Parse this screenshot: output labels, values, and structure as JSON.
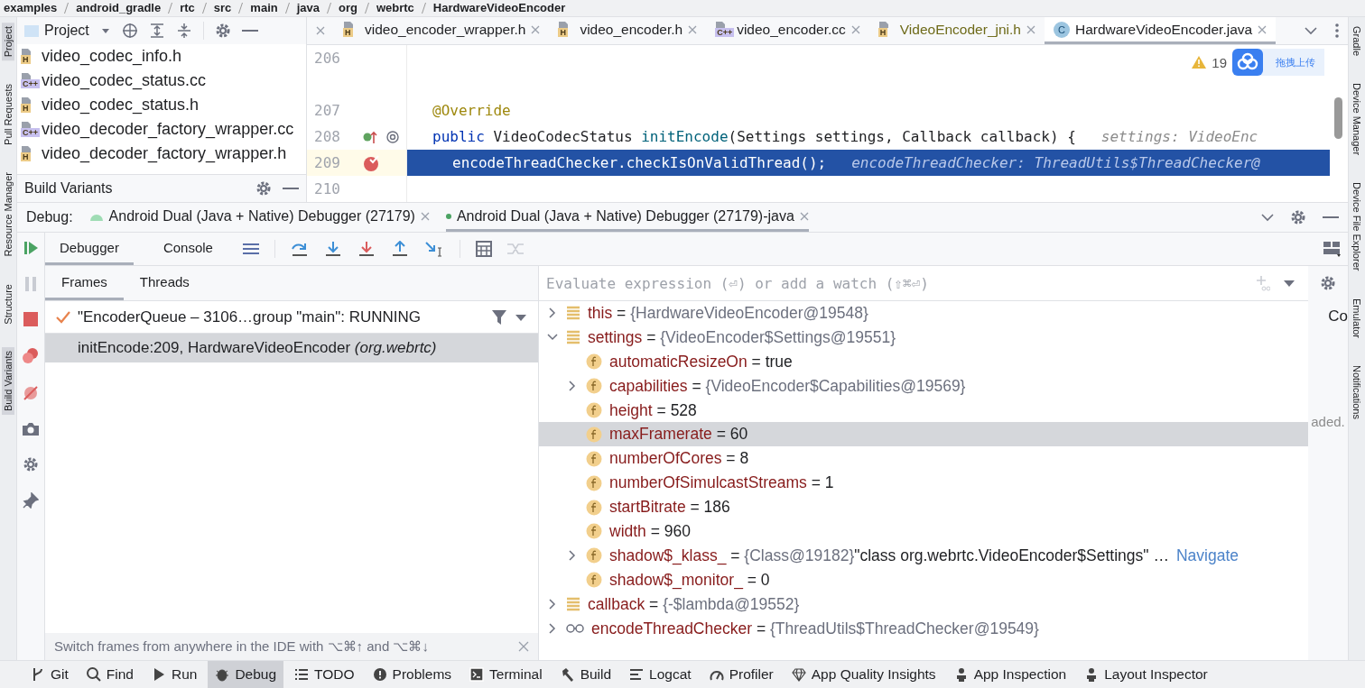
{
  "breadcrumbs": [
    "examples",
    "android_gradle",
    "rtc",
    "src",
    "main",
    "java",
    "org",
    "webrtc",
    "HardwareVideoEncoder"
  ],
  "left_stripe": [
    {
      "label": "Project",
      "selected": true
    },
    {
      "label": "Pull Requests",
      "selected": false
    },
    {
      "label": "Resource Manager",
      "selected": false
    },
    {
      "label": "Structure",
      "selected": false
    },
    {
      "label": "Build Variants",
      "selected": true
    }
  ],
  "right_stripe": [
    {
      "label": "Gradle",
      "selected": false
    },
    {
      "label": "Device Manager",
      "selected": false
    },
    {
      "label": "Device File Explorer",
      "selected": false
    },
    {
      "label": "Emulator",
      "selected": false
    },
    {
      "label": "Notifications",
      "selected": false
    }
  ],
  "project": {
    "title": "Project",
    "files": [
      {
        "name": "video_codec_info.h",
        "badge": "H",
        "color": "#eccb87"
      },
      {
        "name": "video_codec_status.cc",
        "badge": "C++",
        "color": "#c7c0ef"
      },
      {
        "name": "video_codec_status.h",
        "badge": "H",
        "color": "#eccb87"
      },
      {
        "name": "video_decoder_factory_wrapper.cc",
        "badge": "C++",
        "color": "#c7c0ef"
      },
      {
        "name": "video_decoder_factory_wrapper.h",
        "badge": "H",
        "color": "#eccb87"
      }
    ],
    "build_variants": "Build Variants"
  },
  "editor": {
    "tabs": [
      {
        "label": "video_encoder_wrapper.h",
        "kind": "file",
        "badge": "H",
        "color": "#eccb87",
        "modified": false,
        "selected": false
      },
      {
        "label": "video_encoder.h",
        "kind": "file",
        "badge": "H",
        "color": "#eccb87",
        "modified": false,
        "selected": false
      },
      {
        "label": "video_encoder.cc",
        "kind": "file",
        "badge": "C++",
        "color": "#c7c0ef",
        "modified": false,
        "selected": false
      },
      {
        "label": "VideoEncoder_jni.h",
        "kind": "file",
        "badge": "H",
        "color": "#eccb87",
        "modified": true,
        "selected": false
      },
      {
        "label": "HardwareVideoEncoder.java",
        "kind": "class",
        "badge": "C",
        "color": "#9cc5e0",
        "modified": false,
        "selected": true
      }
    ],
    "warnings": "19",
    "upload_widget": "拖拽上传",
    "lines": [
      {
        "number": "206",
        "selected": false
      },
      {
        "number": "207",
        "tokens": [
          {
            "text": "@Override",
            "kind": "annotation"
          }
        ],
        "selected": false
      },
      {
        "number": "208",
        "overrides": true,
        "tokens": [
          {
            "text": "public",
            "kind": "keyword"
          },
          {
            "text": " VideoCodecStatus ",
            "kind": "plain"
          },
          {
            "text": "initEncode",
            "kind": "method"
          },
          {
            "text": "(Settings settings, Callback callback) {",
            "kind": "plain"
          }
        ],
        "hint": "settings: VideoEnc",
        "selected": false
      },
      {
        "number": "209",
        "breakpoint": true,
        "indented": true,
        "tokens": [
          {
            "text": "encodeThreadChecker.checkIsOnValidThread();",
            "kind": "plain"
          }
        ],
        "hint": "encodeThreadChecker: ThreadUtils$ThreadChecker@",
        "selected": true
      },
      {
        "number": "210",
        "selected": false
      }
    ]
  },
  "debug": {
    "label": "Debug:",
    "sessions": [
      {
        "label": "Android Dual (Java + Native) Debugger (27179)",
        "selected": false
      },
      {
        "label": "Android Dual (Java + Native) Debugger (27179)-java",
        "selected": true
      }
    ],
    "tabs": [
      {
        "label": "Debugger",
        "selected": true
      },
      {
        "label": "Console",
        "selected": false
      }
    ],
    "frame_tabs": [
      {
        "label": "Frames",
        "selected": true
      },
      {
        "label": "Threads",
        "selected": false
      }
    ],
    "thread": "\"EncoderQueue – 3106…group \"main\": RUNNING",
    "frames": [
      {
        "method": "initEncode:209, HardwareVideoEncoder",
        "package": "(org.webrtc)",
        "selected": true
      }
    ],
    "hint": "Switch frames from anywhere in the IDE with ⌥⌘↑ and ⌥⌘↓",
    "evaluate_placeholder": "Evaluate expression (⏎) or add a watch (⇧⌘⏎)",
    "variables": [
      {
        "name": "this",
        "operator": "=",
        "value": "{HardwareVideoEncoder@19548}",
        "kind": "local",
        "expandable": true,
        "expanded": false,
        "selected": false
      },
      {
        "name": "settings",
        "operator": "=",
        "value": "{VideoEncoder$Settings@19551}",
        "kind": "local",
        "expandable": true,
        "expanded": true,
        "selected": false,
        "children": [
          {
            "name": "automaticResizeOn",
            "operator": "=",
            "value": "true",
            "kind": "field",
            "expandable": false,
            "expanded": false,
            "selected": false
          },
          {
            "name": "capabilities",
            "operator": "=",
            "value": "{VideoEncoder$Capabilities@19569}",
            "kind": "field",
            "expandable": true,
            "expanded": false,
            "selected": false
          },
          {
            "name": "height",
            "operator": "=",
            "value": "528",
            "kind": "field",
            "expandable": false,
            "expanded": false,
            "selected": false
          },
          {
            "name": "maxFramerate",
            "operator": "=",
            "value": "60",
            "kind": "field",
            "expandable": false,
            "expanded": false,
            "selected": true
          },
          {
            "name": "numberOfCores",
            "operator": "=",
            "value": "8",
            "kind": "field",
            "expandable": false,
            "expanded": false,
            "selected": false
          },
          {
            "name": "numberOfSimulcastStreams",
            "operator": "=",
            "value": "1",
            "kind": "field",
            "expandable": false,
            "expanded": false,
            "selected": false
          },
          {
            "name": "startBitrate",
            "operator": "=",
            "value": "186",
            "kind": "field",
            "expandable": false,
            "expanded": false,
            "selected": false
          },
          {
            "name": "width",
            "operator": "=",
            "value": "960",
            "kind": "field",
            "expandable": false,
            "expanded": false,
            "selected": false
          },
          {
            "name": "shadow$_klass_",
            "operator": "=",
            "value": "{Class@19182}",
            "extra": "\"class org.webrtc.VideoEncoder$Settings\" …",
            "link": "Navigate",
            "kind": "field",
            "expandable": true,
            "expanded": false,
            "selected": false
          },
          {
            "name": "shadow$_monitor_",
            "operator": "=",
            "value": "0",
            "kind": "field",
            "expandable": false,
            "expanded": false,
            "selected": false
          }
        ]
      },
      {
        "name": "callback",
        "operator": "=",
        "value": "{-$lambda@19552}",
        "kind": "local",
        "expandable": true,
        "expanded": false,
        "selected": false
      },
      {
        "name": "encodeThreadChecker",
        "operator": "=",
        "value": "{ThreadUtils$ThreadChecker@19549}",
        "kind": "watch",
        "expandable": true,
        "expanded": false,
        "selected": false
      }
    ],
    "side_panel": [
      "Co",
      "aded."
    ]
  },
  "tool_windows": [
    {
      "label": "Git",
      "selected": false
    },
    {
      "label": "Find",
      "selected": false
    },
    {
      "label": "Run",
      "selected": false
    },
    {
      "label": "Debug",
      "selected": true
    },
    {
      "label": "TODO",
      "selected": false
    },
    {
      "label": "Problems",
      "selected": false
    },
    {
      "label": "Terminal",
      "selected": false
    },
    {
      "label": "Build",
      "selected": false
    },
    {
      "label": "Logcat",
      "selected": false
    },
    {
      "label": "Profiler",
      "selected": false
    },
    {
      "label": "App Quality Insights",
      "selected": false
    },
    {
      "label": "App Inspection",
      "selected": false
    },
    {
      "label": "Layout Inspector",
      "selected": false
    }
  ]
}
